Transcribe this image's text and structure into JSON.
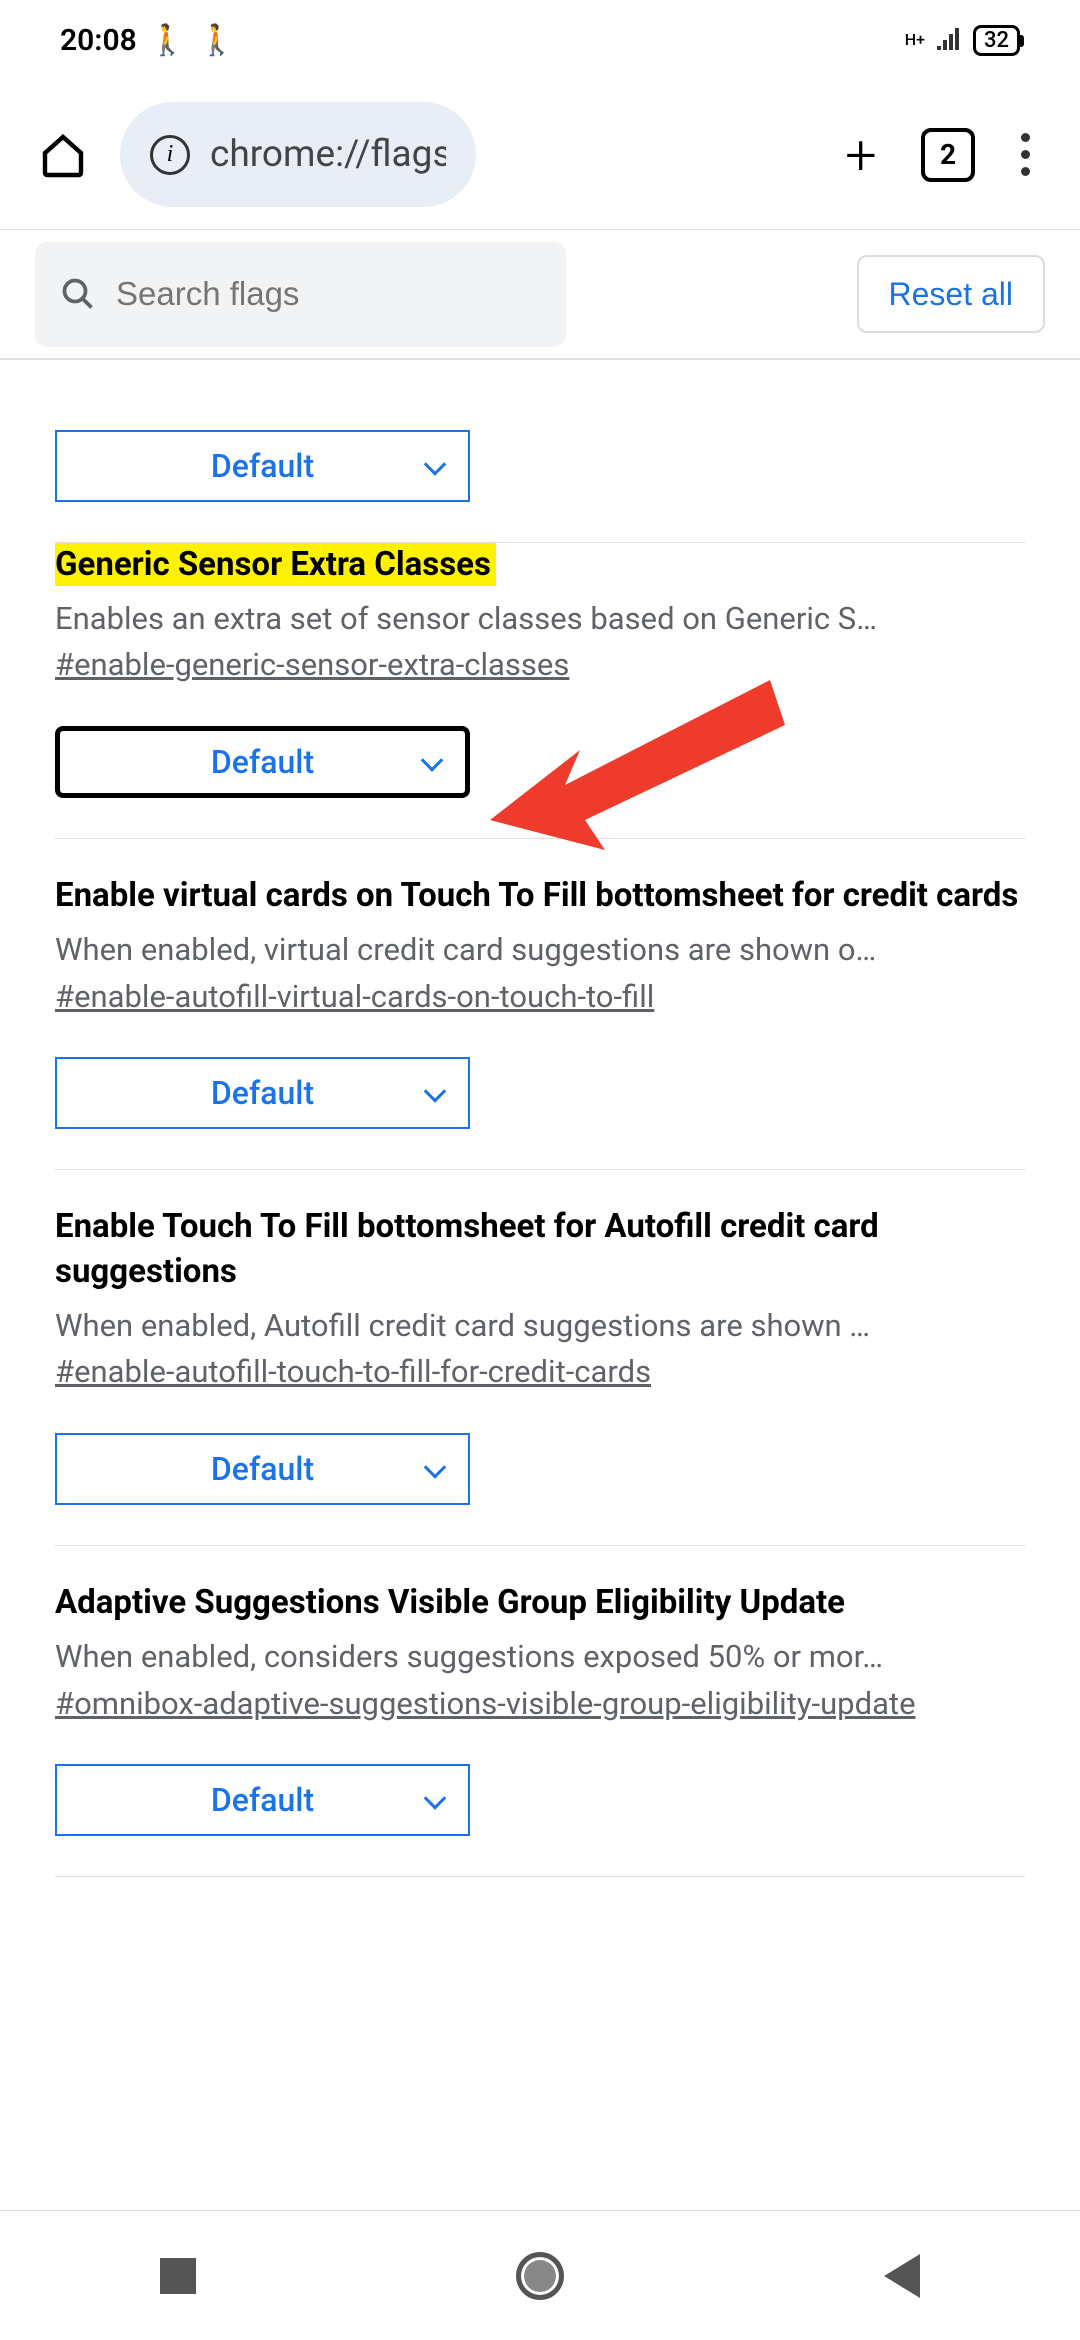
{
  "status": {
    "time": "20:08",
    "battery": "32",
    "network": "H+"
  },
  "browser": {
    "url": "chrome://flags/#enab",
    "tab_count": "2"
  },
  "search": {
    "placeholder": "Search flags",
    "reset_label": "Reset all"
  },
  "top_select": {
    "value": "Default"
  },
  "flags": [
    {
      "title": "Generic Sensor Extra Classes",
      "desc": "Enables an extra set of sensor classes based on Generic S…",
      "hash": "#enable-generic-sensor-extra-classes",
      "value": "Default",
      "highlighted": true,
      "focused": true
    },
    {
      "title": "Enable virtual cards on Touch To Fill bottomsheet for credit cards",
      "desc": "When enabled, virtual credit card suggestions are shown o…",
      "hash": "#enable-autofill-virtual-cards-on-touch-to-fill",
      "value": "Default"
    },
    {
      "title": "Enable Touch To Fill bottomsheet for Autofill credit card suggestions",
      "desc": "When enabled, Autofill credit card suggestions are shown …",
      "hash": "#enable-autofill-touch-to-fill-for-credit-cards",
      "value": "Default"
    },
    {
      "title": "Adaptive Suggestions Visible Group Eligibility Update",
      "desc": "When enabled, considers suggestions exposed 50% or mor…",
      "hash": "#omnibox-adaptive-suggestions-visible-group-eligibility-update",
      "value": "Default"
    }
  ]
}
